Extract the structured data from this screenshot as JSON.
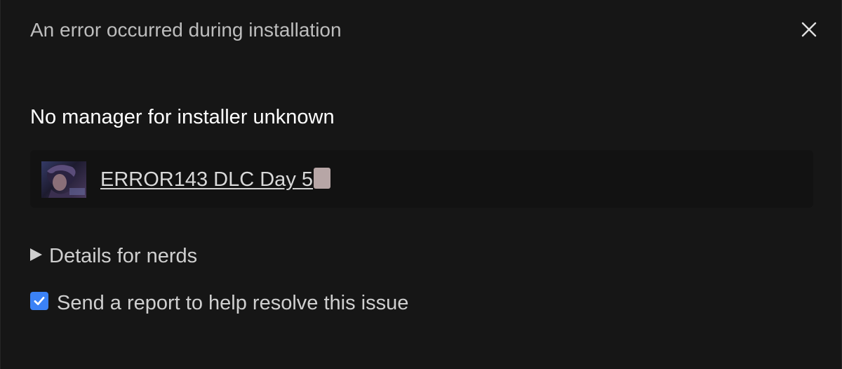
{
  "dialog": {
    "title": "An error occurred during installation",
    "close_icon": "close-icon"
  },
  "error": {
    "message": "No manager for installer unknown"
  },
  "game": {
    "title": "ERROR143 DLC Day 5",
    "thumbnail_icon": "game-cover-thumbnail"
  },
  "details": {
    "label": "Details for nerds",
    "icon": "triangle-right-icon",
    "expanded": false
  },
  "report": {
    "label": "Send a report to help resolve this issue",
    "checked": true
  },
  "colors": {
    "background": "#161616",
    "row_background": "#121212",
    "checkbox_accent": "#3b82f6",
    "heading_text": "#ffffff",
    "muted_text": "#bdbdbd"
  }
}
